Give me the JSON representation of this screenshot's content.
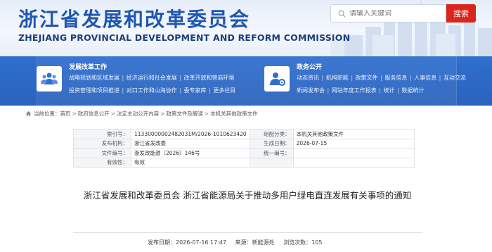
{
  "header": {
    "title": "浙江省发展和改革委员会",
    "subtitle": "ZHEJIANG PROVINCIAL DEVELOPMENT AND REFORM COMMISSION",
    "search_placeholder": "请输入关键词",
    "search_button": "搜索"
  },
  "nav": {
    "work": {
      "title": "发展改革工作",
      "line1": [
        "战略规划和区域发展",
        "经济运行和社会发展",
        "改革开放和营商环境"
      ],
      "line2": [
        "投资管理和项目推进",
        "对口工作和山海协作",
        "委专家库",
        "更多栏目"
      ]
    },
    "open": {
      "title": "政务公开",
      "line1": [
        "动态资讯",
        "机构职能",
        "政策文件",
        "服务信息",
        "人事信息",
        "互动交流"
      ],
      "line2": [
        "新闻发布会",
        "网站年度工作报表",
        "统计",
        "数据统计"
      ]
    }
  },
  "breadcrumb": {
    "label": "当前位置：",
    "items": [
      "首页",
      "政府信息公开",
      "法定主动公开内容",
      "政策文件及解读",
      "本机关其他政策文件"
    ]
  },
  "info": {
    "rows": [
      {
        "k1": "索引号：",
        "v1": "11330000002482031M/2026-1010623420",
        "k2": "组配分类：",
        "v2": "本机关其他政策文件"
      },
      {
        "k1": "发布机构：",
        "v1": "浙江省发改委",
        "k2": "生成日期：",
        "v2": "2026-07-15"
      },
      {
        "k1": "文件编号：",
        "v1": "浙发改能源〔2026〕146号",
        "k2": "统一编号：",
        "v2": ""
      },
      {
        "k1": "有效性：",
        "v1": "有效",
        "k2": "",
        "v2": ""
      }
    ]
  },
  "article": {
    "title": "浙江省发展和改革委员会 浙江省能源局关于推动多用户绿电直连发展有关事项的通知",
    "meta": {
      "date_label": "发布日期：",
      "date": "2026-07-16 17:47",
      "source_label": "来源：",
      "source": "新能源处",
      "views_label": "浏览次数：",
      "views": "105"
    }
  },
  "colors": {
    "brand_blue": "#1f57b0",
    "nav_blue": "#2f6fce",
    "search_red": "#d9261c"
  }
}
